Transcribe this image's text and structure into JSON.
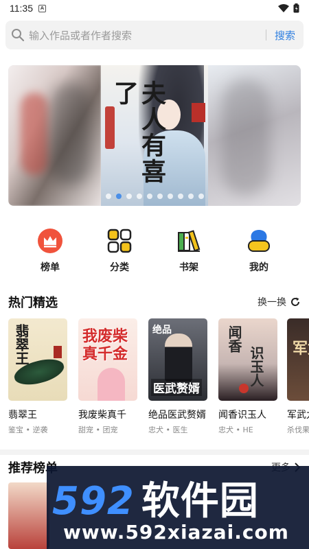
{
  "status_bar": {
    "time": "11:35",
    "notification_letter": "A"
  },
  "search": {
    "placeholder": "输入作品或者作者搜索",
    "button_label": "搜索"
  },
  "banner": {
    "cover_title": "夫人有喜了",
    "dot_count": 10,
    "active_dot_index": 1
  },
  "quick_nav": [
    {
      "label": "榜单",
      "icon": "crown-icon"
    },
    {
      "label": "分类",
      "icon": "grid-icon"
    },
    {
      "label": "书架",
      "icon": "bookshelf-icon"
    },
    {
      "label": "我的",
      "icon": "profile-icon"
    }
  ],
  "hot_section": {
    "title": "热门精选",
    "refresh_label": "换一换",
    "books": [
      {
        "title": "翡翠王",
        "tags": "鉴宝 • 逆袭",
        "cover_text": "翡翠王"
      },
      {
        "title": "我废柴真千",
        "tags": "甜宠 • 团宠",
        "cover_text": "我废柴真千金"
      },
      {
        "title": "绝品医武赘婿",
        "tags": "忠犬 • 医生",
        "cover_text": "医武赘婿",
        "cover_top": "绝品"
      },
      {
        "title": "闻香识玉人",
        "tags": "忠犬 • HE",
        "cover_text": "闻香",
        "cover_text2": "识玉人"
      },
      {
        "title": "军武九",
        "tags": "杀伐果",
        "cover_text": "军武"
      }
    ]
  },
  "ranking_section": {
    "title": "推荐榜单",
    "more_label": "更多"
  },
  "watermark": {
    "brand": "592",
    "brand_cn": "软件园",
    "url": "www.592xiazai.com"
  },
  "colors": {
    "accent": "#2f7fe0",
    "crown_red": "#f0533c",
    "profile_yellow": "#f5c51e",
    "profile_blue": "#2b78e4"
  }
}
